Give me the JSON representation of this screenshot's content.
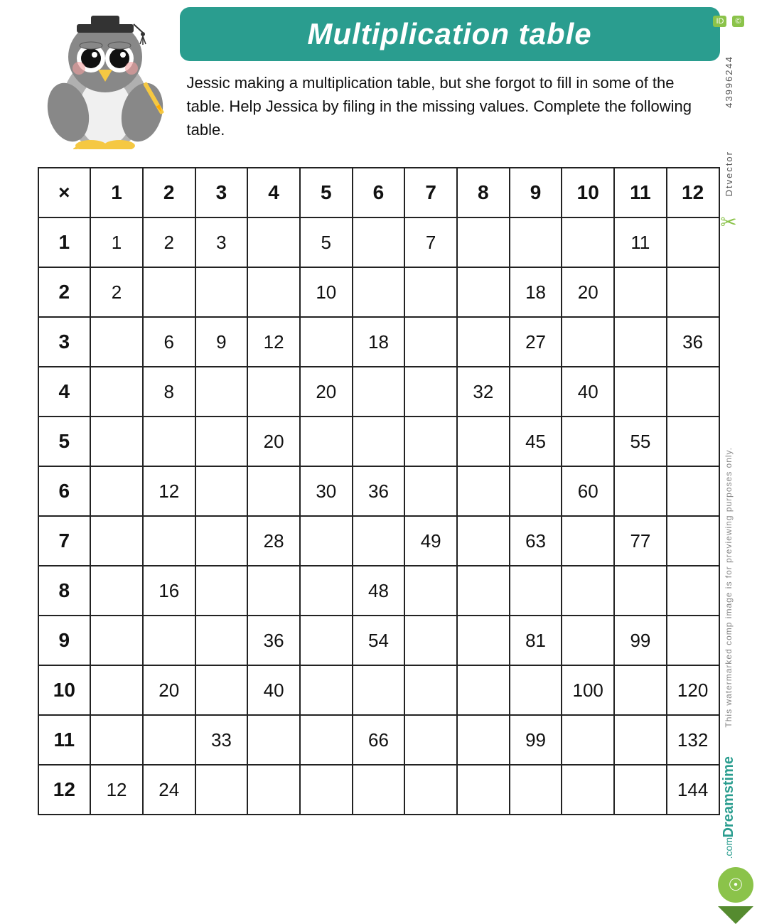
{
  "header": {
    "title": "Multiplication table",
    "description": "Jessic making a multiplication table, but she forgot to fill in some of the table. Help Jessica by filing in the missing values. Complete the following table.",
    "watermark_id": "43996244",
    "site_name": "Dreamstime.com",
    "dtvector": "Dtvector"
  },
  "table": {
    "header_row": [
      "×",
      "1",
      "2",
      "3",
      "4",
      "5",
      "6",
      "7",
      "8",
      "9",
      "10",
      "11",
      "12"
    ],
    "rows": [
      {
        "label": "1",
        "cells": [
          "1",
          "2",
          "3",
          "",
          "5",
          "",
          "7",
          "",
          "",
          "",
          "11",
          ""
        ]
      },
      {
        "label": "2",
        "cells": [
          "2",
          "",
          "",
          "",
          "10",
          "",
          "",
          "",
          "18",
          "20",
          "",
          ""
        ]
      },
      {
        "label": "3",
        "cells": [
          "",
          "6",
          "9",
          "12",
          "",
          "18",
          "",
          "",
          "27",
          "",
          "",
          "36"
        ]
      },
      {
        "label": "4",
        "cells": [
          "",
          "8",
          "",
          "",
          "20",
          "",
          "",
          "32",
          "",
          "40",
          "",
          ""
        ]
      },
      {
        "label": "5",
        "cells": [
          "",
          "",
          "",
          "20",
          "",
          "",
          "",
          "",
          "45",
          "",
          "55",
          ""
        ]
      },
      {
        "label": "6",
        "cells": [
          "",
          "12",
          "",
          "",
          "30",
          "36",
          "",
          "",
          "",
          "60",
          "",
          ""
        ]
      },
      {
        "label": "7",
        "cells": [
          "",
          "",
          "",
          "28",
          "",
          "",
          "49",
          "",
          "63",
          "",
          "77",
          ""
        ]
      },
      {
        "label": "8",
        "cells": [
          "",
          "16",
          "",
          "",
          "",
          "48",
          "",
          "",
          "",
          "",
          "",
          ""
        ]
      },
      {
        "label": "9",
        "cells": [
          "",
          "",
          "",
          "36",
          "",
          "54",
          "",
          "",
          "81",
          "",
          "99",
          ""
        ]
      },
      {
        "label": "10",
        "cells": [
          "",
          "20",
          "",
          "40",
          "",
          "",
          "",
          "",
          "",
          "100",
          "",
          "120"
        ]
      },
      {
        "label": "11",
        "cells": [
          "",
          "",
          "33",
          "",
          "",
          "66",
          "",
          "",
          "99",
          "",
          "",
          "132"
        ]
      },
      {
        "label": "12",
        "cells": [
          "12",
          "24",
          "",
          "",
          "",
          "",
          "",
          "",
          "",
          "",
          "",
          "144"
        ]
      }
    ]
  }
}
